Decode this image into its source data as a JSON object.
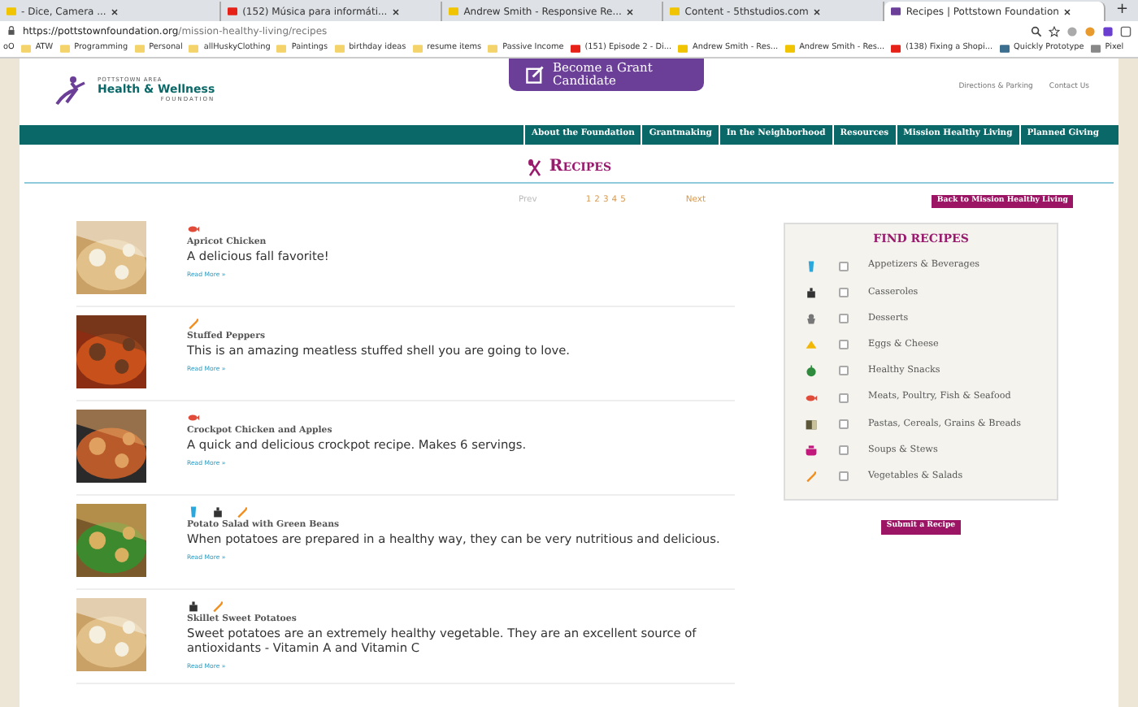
{
  "browser": {
    "tabs": [
      {
        "title": "- Dice, Camera ...",
        "kind": "page",
        "selected": false
      },
      {
        "title": "(152) Música para informáti...",
        "kind": "youtube",
        "selected": false
      },
      {
        "title": "Andrew Smith - Responsive Re...",
        "kind": "page",
        "selected": false
      },
      {
        "title": "Content - 5thstudios.com",
        "kind": "page",
        "selected": false
      },
      {
        "title": "Recipes | Pottstown Foundation",
        "kind": "site",
        "selected": true
      }
    ],
    "new_tab": "+",
    "address": {
      "host": "https://pottstownfoundation.org",
      "path": "/mission-healthy-living/recipes"
    },
    "bookmarks": [
      {
        "label": "oO",
        "kind": "none"
      },
      {
        "label": "ATW",
        "kind": "folder"
      },
      {
        "label": "Programming",
        "kind": "folder"
      },
      {
        "label": "Personal",
        "kind": "folder"
      },
      {
        "label": "allHuskyClothing",
        "kind": "folder"
      },
      {
        "label": "Paintings",
        "kind": "folder"
      },
      {
        "label": "birthday ideas",
        "kind": "folder"
      },
      {
        "label": "resume items",
        "kind": "folder"
      },
      {
        "label": "Passive Income",
        "kind": "folder"
      },
      {
        "label": "(151) Episode 2 - Di...",
        "kind": "youtube"
      },
      {
        "label": "Andrew Smith - Res...",
        "kind": "page"
      },
      {
        "label": "Andrew Smith - Res...",
        "kind": "page"
      },
      {
        "label": "(138) Fixing a Shopi...",
        "kind": "youtube"
      },
      {
        "label": "Quickly Prototype",
        "kind": "other"
      },
      {
        "label": "Pixel",
        "kind": "doc"
      }
    ]
  },
  "header": {
    "logo": {
      "top": "POTTSTOWN AREA",
      "main": "Health & Wellness",
      "bottom": "FOUNDATION"
    },
    "grant_button": "Become a Grant Candidate",
    "links": [
      "Directions & Parking",
      "Contact Us"
    ]
  },
  "nav": [
    "About the Foundation",
    "Grantmaking",
    "In the Neighborhood",
    "Resources",
    "Mission Healthy Living",
    "Planned Giving"
  ],
  "page_title": "Recipes",
  "pagination": {
    "prev": "Prev",
    "pages": [
      "1",
      "2",
      "3",
      "4",
      "5"
    ],
    "next": "Next"
  },
  "back_button": "Back to Mission Healthy Living",
  "recipes": [
    {
      "title": "Apricot Chicken",
      "description": "A delicious fall favorite!",
      "link": "Read More »",
      "tags": [
        {
          "kind": "meat"
        }
      ]
    },
    {
      "title": "Stuffed Peppers",
      "description": "This is an amazing meatless stuffed shell you are going to love.",
      "link": "Read More »",
      "tags": [
        {
          "kind": "vegetable"
        }
      ]
    },
    {
      "title": "Crockpot Chicken and Apples",
      "description": "A quick and delicious crockpot recipe. Makes 6 servings.",
      "link": "Read More »",
      "tags": [
        {
          "kind": "meat"
        }
      ]
    },
    {
      "title": "Potato Salad with Green Beans",
      "description": "When potatoes are prepared in a healthy way, they can be very nutritious and delicious.",
      "link": "Read More »",
      "tags": [
        {
          "kind": "drink"
        },
        {
          "kind": "casserole"
        },
        {
          "kind": "vegetable"
        }
      ]
    },
    {
      "title": "Skillet Sweet Potatoes",
      "description": "Sweet potatoes are an extremely healthy vegetable. They are an excellent source of antioxidants - Vitamin A and Vitamin C",
      "link": "Read More »",
      "tags": [
        {
          "kind": "casserole"
        },
        {
          "kind": "vegetable"
        }
      ]
    }
  ],
  "find_recipes": {
    "title": "FIND RECIPES",
    "categories": [
      {
        "label": "Appetizers & Beverages",
        "kind": "drink",
        "checked": false
      },
      {
        "label": "Casseroles",
        "kind": "casserole",
        "checked": false
      },
      {
        "label": "Desserts",
        "kind": "dessert",
        "checked": false
      },
      {
        "label": "Eggs & Cheese",
        "kind": "cheese",
        "checked": false
      },
      {
        "label": "Healthy Snacks",
        "kind": "apple",
        "checked": false
      },
      {
        "label": "Meats, Poultry, Fish & Seafood",
        "kind": "meat",
        "checked": false
      },
      {
        "label": "Pastas, Cereals, Grains & Breads",
        "kind": "pasta",
        "checked": false
      },
      {
        "label": "Soups & Stews",
        "kind": "soup",
        "checked": false
      },
      {
        "label": "Vegetables & Salads",
        "kind": "vegetable",
        "checked": false
      }
    ],
    "submit": "Submit a Recipe"
  }
}
